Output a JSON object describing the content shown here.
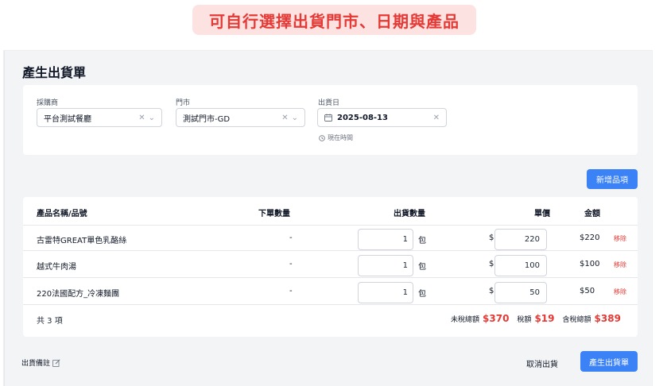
{
  "banner": "可自行選擇出貨門市、日期與產品",
  "page_title": "產生出貨單",
  "filters": {
    "buyer_label": "採購商",
    "buyer_value": "平台測試餐廳",
    "store_label": "門市",
    "store_value": "測試門市-GD",
    "date_label": "出貨日",
    "date_value": "2025-08-13",
    "now_hint": "現在時間"
  },
  "add_item_label": "新增品項",
  "table": {
    "headers": [
      "產品名稱/品號",
      "下單數量",
      "出貨數量",
      "單價",
      "金額"
    ],
    "rows": [
      {
        "name": "古雷特GREAT單色乳酪絲",
        "ordered": "-",
        "qty": "1",
        "unit": "包",
        "currency": "$",
        "price": "220",
        "amount": "$220",
        "remove": "移除"
      },
      {
        "name": "越式牛肉湯",
        "ordered": "-",
        "qty": "1",
        "unit": "包",
        "currency": "$",
        "price": "100",
        "amount": "$100",
        "remove": "移除"
      },
      {
        "name": "220法國配方_冷凍麵團",
        "ordered": "-",
        "qty": "1",
        "unit": "包",
        "currency": "$",
        "price": "50",
        "amount": "$50",
        "remove": "移除"
      }
    ],
    "count_text": "共 3 項",
    "subtotal_label": "未稅總額",
    "subtotal": "$370",
    "tax_label": "稅額",
    "tax": "$19",
    "total_label": "含稅總額",
    "total": "$389"
  },
  "footer": {
    "note_label": "出貨備註",
    "cancel_label": "取消出貨",
    "submit_label": "產生出貨單"
  },
  "colors": {
    "accent": "#3b82f6",
    "danger": "#e53935",
    "banner_bg": "#fde2e2"
  }
}
